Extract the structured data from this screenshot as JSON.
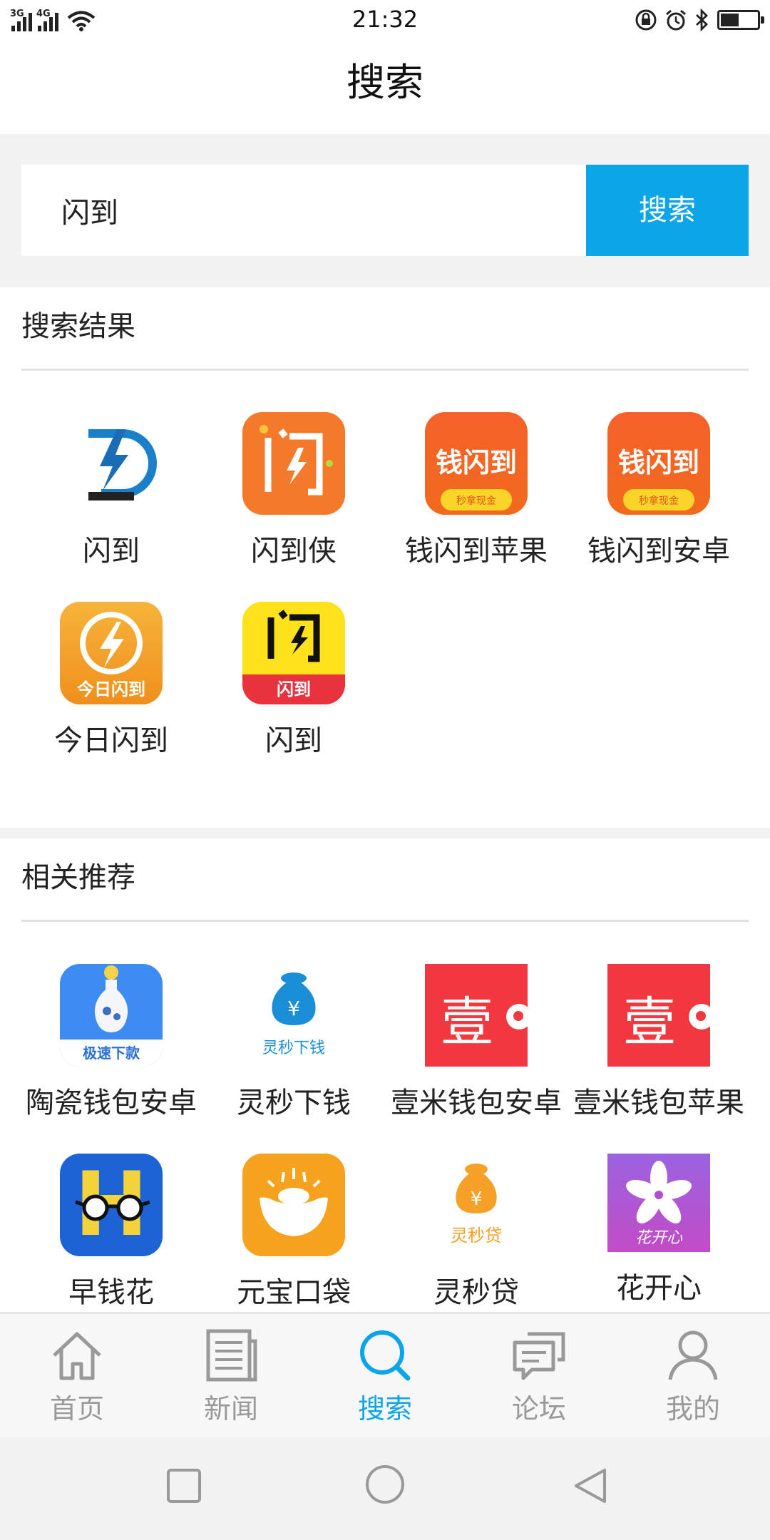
{
  "status_bar": {
    "time": "21:32",
    "network_1": "3G",
    "network_2": "4G",
    "icons": [
      "signal-icon",
      "wifi-icon",
      "lock-rotation-icon",
      "alarm-icon",
      "bluetooth-icon",
      "battery-icon"
    ]
  },
  "header": {
    "title": "搜索"
  },
  "search": {
    "value": "闪到",
    "placeholder": "",
    "button_label": "搜索"
  },
  "results": {
    "title": "搜索结果",
    "apps": [
      {
        "name": "闪到"
      },
      {
        "name": "闪到侠"
      },
      {
        "name": "钱闪到苹果",
        "icon_text": "钱闪到",
        "icon_sub": "秒拿现金"
      },
      {
        "name": "钱闪到安卓",
        "icon_text": "钱闪到",
        "icon_sub": "秒拿现金"
      },
      {
        "name": "今日闪到",
        "icon_text": "今日闪到"
      },
      {
        "name": "闪到",
        "icon_text": "闪到"
      }
    ]
  },
  "recommend": {
    "title": "相关推荐",
    "apps": [
      {
        "name": "陶瓷钱包安卓",
        "icon_text": "极速下款"
      },
      {
        "name": "灵秒下钱",
        "icon_text": "灵秒下钱"
      },
      {
        "name": "壹米钱包安卓",
        "icon_text": "壹"
      },
      {
        "name": "壹米钱包苹果",
        "icon_text": "壹"
      },
      {
        "name": "早钱花",
        "icon_text": "H"
      },
      {
        "name": "元宝口袋"
      },
      {
        "name": "灵秒贷",
        "icon_text": "灵秒贷"
      },
      {
        "name": "花开心",
        "icon_text": "花开心"
      }
    ]
  },
  "tabbar": {
    "active": "搜索",
    "tabs": [
      {
        "label": "首页",
        "icon": "home-icon"
      },
      {
        "label": "新闻",
        "icon": "news-icon"
      },
      {
        "label": "搜索",
        "icon": "search-icon"
      },
      {
        "label": "论坛",
        "icon": "forum-icon"
      },
      {
        "label": "我的",
        "icon": "profile-icon"
      }
    ]
  },
  "system_nav": {
    "icons": [
      "recent-apps-icon",
      "home-circle-icon",
      "back-triangle-icon"
    ]
  },
  "colors": {
    "accent": "#0ba5e8",
    "tab_inactive": "#999999"
  }
}
